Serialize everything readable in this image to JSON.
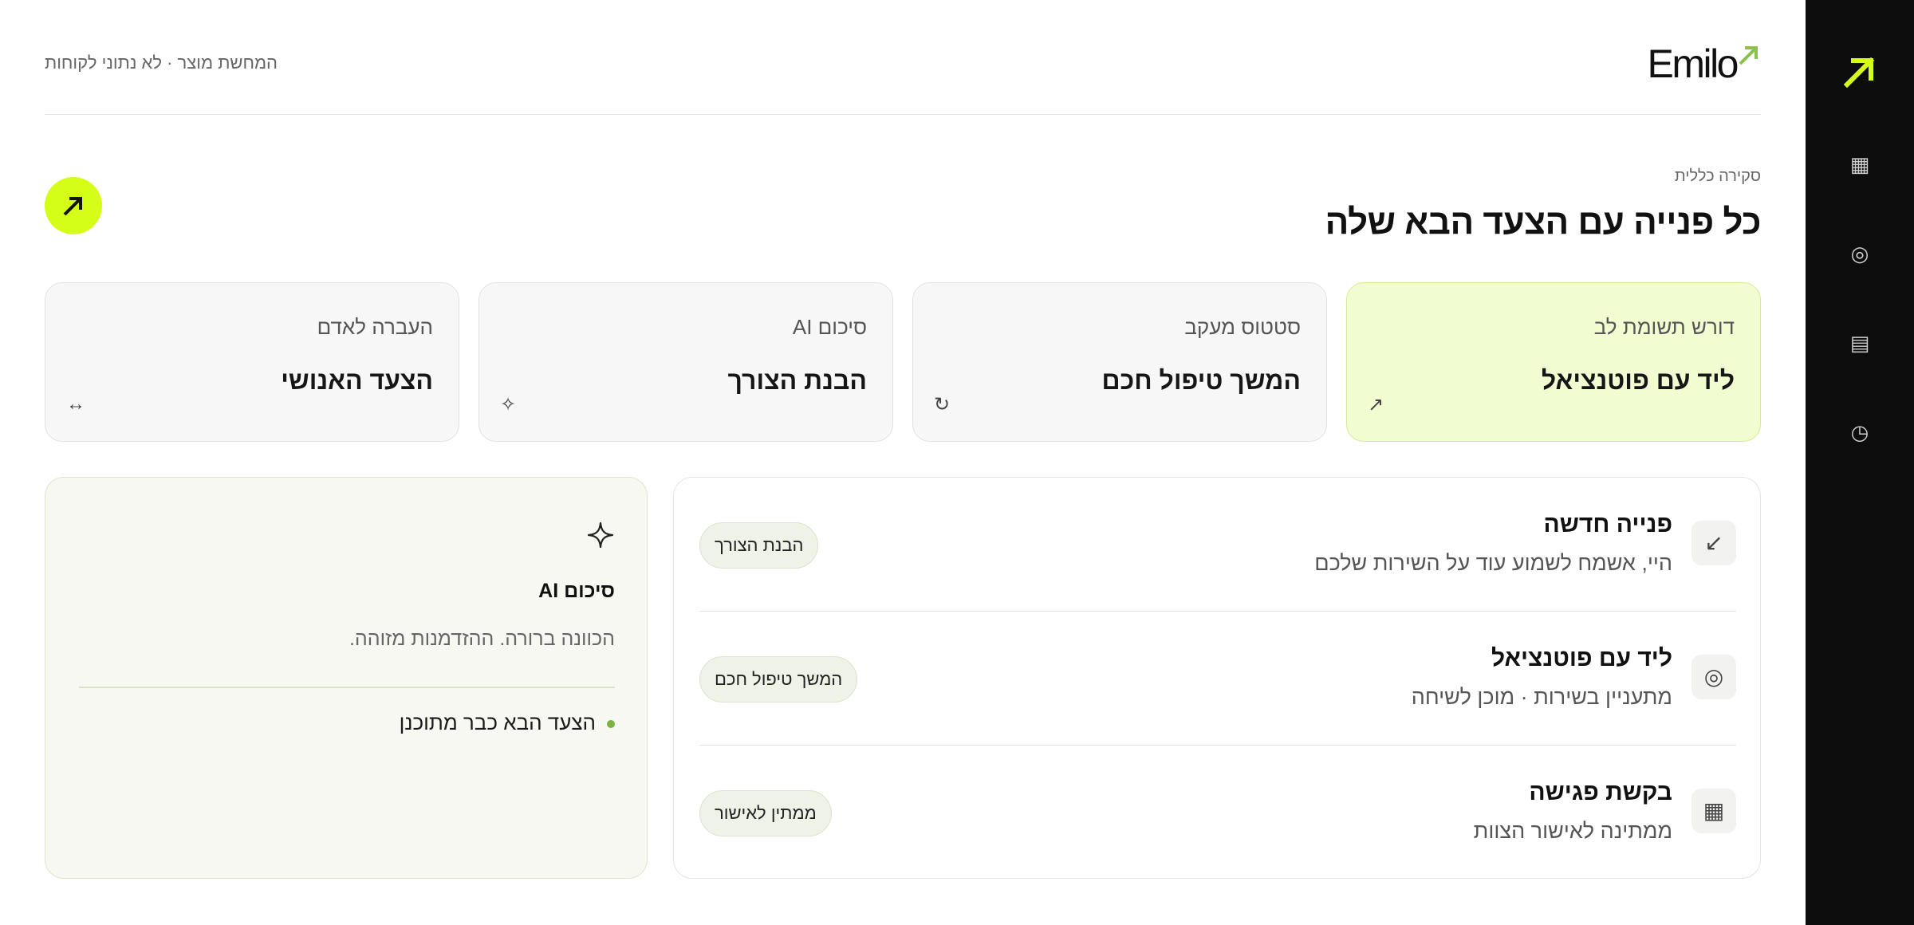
{
  "header": {
    "note": "המחשת מוצר · לא נתוני לקוחות",
    "brand": "Emilo"
  },
  "colors": {
    "accent": "#d4fd18",
    "rail": "#0d0d0d",
    "active_card": "#f1fcd1",
    "status_dot": "#7cb342"
  },
  "rail": {
    "icons": [
      "grid-icon",
      "target-icon",
      "list-icon",
      "clock-icon"
    ]
  },
  "overview": {
    "eyebrow": "סקירה כללית",
    "title": "כל פנייה עם הצעד הבא שלה"
  },
  "cards": [
    {
      "label": "דורש תשומת לב",
      "title": "ליד עם פוטנציאל",
      "icon": "↗"
    },
    {
      "label": "סטטוס מעקב",
      "title": "המשך טיפול חכם",
      "icon": "↻"
    },
    {
      "label": "סיכום AI",
      "title": "הבנת הצורך",
      "icon": "✧"
    },
    {
      "label": "העברה לאדם",
      "title": "הצעד האנושי",
      "icon": "↔"
    }
  ],
  "rows": [
    {
      "title": "פנייה חדשה",
      "subtitle": "היי, אשמח לשמוע עוד על השירות שלכם",
      "chip": "הבנת הצורך",
      "icon": "↙"
    },
    {
      "title": "ליד עם פוטנציאל",
      "subtitle": "מתעניין בשירות · מוכן לשיחה",
      "chip": "המשך טיפול חכם",
      "icon": "◎"
    },
    {
      "title": "בקשת פגישה",
      "subtitle": "ממתינה לאישור הצוות",
      "chip": "ממתין לאישור",
      "icon": "▦"
    }
  ],
  "ai_summary": {
    "title": "סיכום AI",
    "text": "הכוונה ברורה. ההזדמנות מזוהה.",
    "status": "הצעד הבא כבר מתוכנן"
  }
}
